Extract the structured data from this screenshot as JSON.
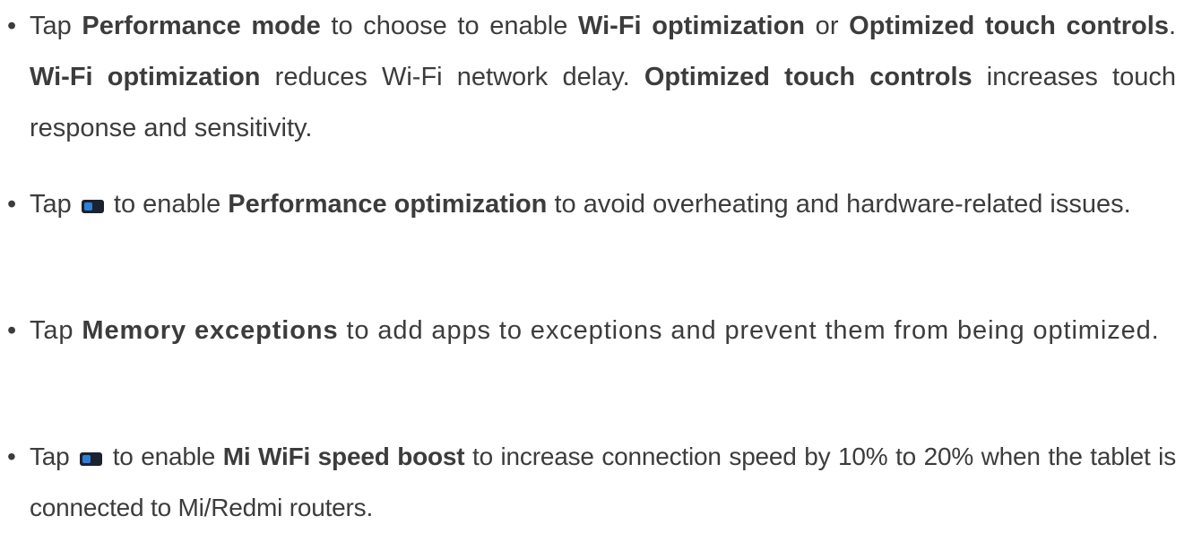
{
  "bullet_char": "•",
  "items": [
    {
      "p1": "Tap ",
      "b1": "Performance mode",
      "p2": " to choose to enable ",
      "b2": "Wi-Fi optimization",
      "p3": " or ",
      "b3": "Optimized touch controls",
      "p4": ". ",
      "b4": "Wi-Fi optimization",
      "p5": " reduces Wi-Fi network delay. ",
      "b5": "Optimized touch controls",
      "p6": " increases touch response and sensitivity."
    },
    {
      "p1": "Tap ",
      "icon": "toggle-switch-icon",
      "p2": " to enable ",
      "b1": "Performance optimization",
      "p3": " to avoid overheating and hardware-related issues."
    },
    {
      "p1": "Tap ",
      "b1": "Memory exceptions",
      "p2": " to add apps to exceptions and prevent them from being optimized."
    },
    {
      "p1": "Tap ",
      "icon": "toggle-switch-icon",
      "p2": " to enable ",
      "b1": "Mi WiFi speed boost",
      "p3": " to increase connection speed by 10% to 20% when the tablet is connected to Mi/Redmi routers."
    }
  ],
  "colors": {
    "text": "#3c3c3c",
    "icon_body": "#1b2230",
    "icon_knob": "#2f7fd8"
  }
}
